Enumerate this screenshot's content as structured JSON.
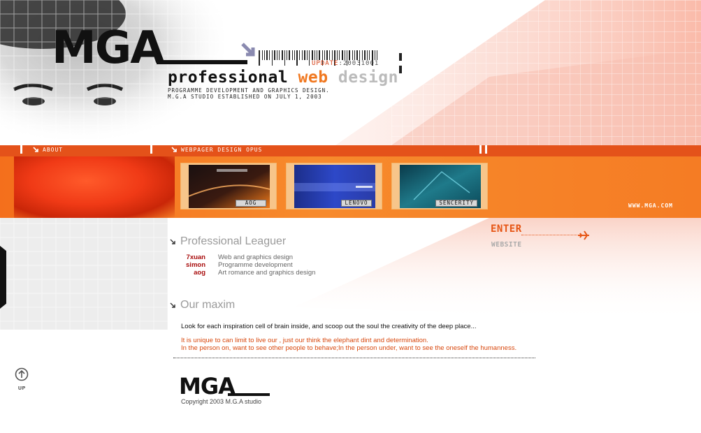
{
  "header": {
    "logo_text": "MGA",
    "update_label": "UPDATE",
    "update_value": ":20031001",
    "tagline_part1": "professional ",
    "tagline_part2": "web",
    "tagline_part3": " design",
    "subline_1": "PROGRAMME DEVELOPMENT AND GRAPHICS DESIGN.",
    "subline_2": "M.G.A STUDIO ESTABLISHED ON JULY 1, 2003"
  },
  "nav": {
    "about": "ABOUT",
    "opus": "WEBPAGER DESIGN OPUS"
  },
  "opus": {
    "items": [
      {
        "label": "AOG"
      },
      {
        "label": "LENOVO"
      },
      {
        "label": "SENCERITY"
      }
    ]
  },
  "site_url": "WWW.MGA.COM",
  "enter": {
    "label": "ENTER",
    "sub": "WEBSITE"
  },
  "leaguer": {
    "title": "Professional Leaguer",
    "members": [
      {
        "name": "7xuan",
        "role": "Web and graphics design"
      },
      {
        "name": "simon",
        "role": "Programme development"
      },
      {
        "name": "aog",
        "role": "Art romance and graphics design"
      }
    ]
  },
  "maxim": {
    "title": "Our maxim",
    "line1": "Look for each inspiration cell of brain inside, and scoop out the soul the creativity of the deep place...",
    "line2": "It is unique to can limit to live our , just our think the elephant dint and determination.",
    "line3": "In the person on, want to see other people to behave;In the person under, want to see the oneself the humanness."
  },
  "footer": {
    "logo_text": "MGA",
    "copyright": "Copyright 2003 M.G.A studio",
    "up_label": "UP"
  },
  "colors": {
    "orange": "#f47a22",
    "orange_dark": "#e4521a",
    "red_text": "#a80c0c"
  }
}
